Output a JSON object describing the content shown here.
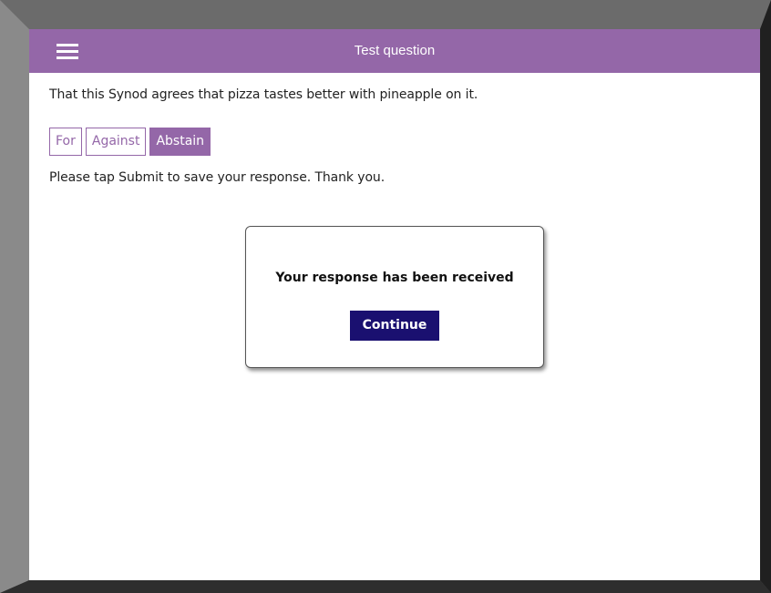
{
  "header": {
    "title": "Test question",
    "menu_icon": "hamburger-menu-icon"
  },
  "question": {
    "text": "That this Synod agrees that pizza tastes better with pineapple on it."
  },
  "options": [
    {
      "label": "For",
      "selected": false
    },
    {
      "label": "Against",
      "selected": false
    },
    {
      "label": "Abstain",
      "selected": true
    }
  ],
  "instruction": "Please tap Submit to save your response. Thank you.",
  "modal": {
    "message": "Your response has been received",
    "continue_label": "Continue"
  },
  "colors": {
    "accent": "#9467a8",
    "button": "#1a1070"
  }
}
